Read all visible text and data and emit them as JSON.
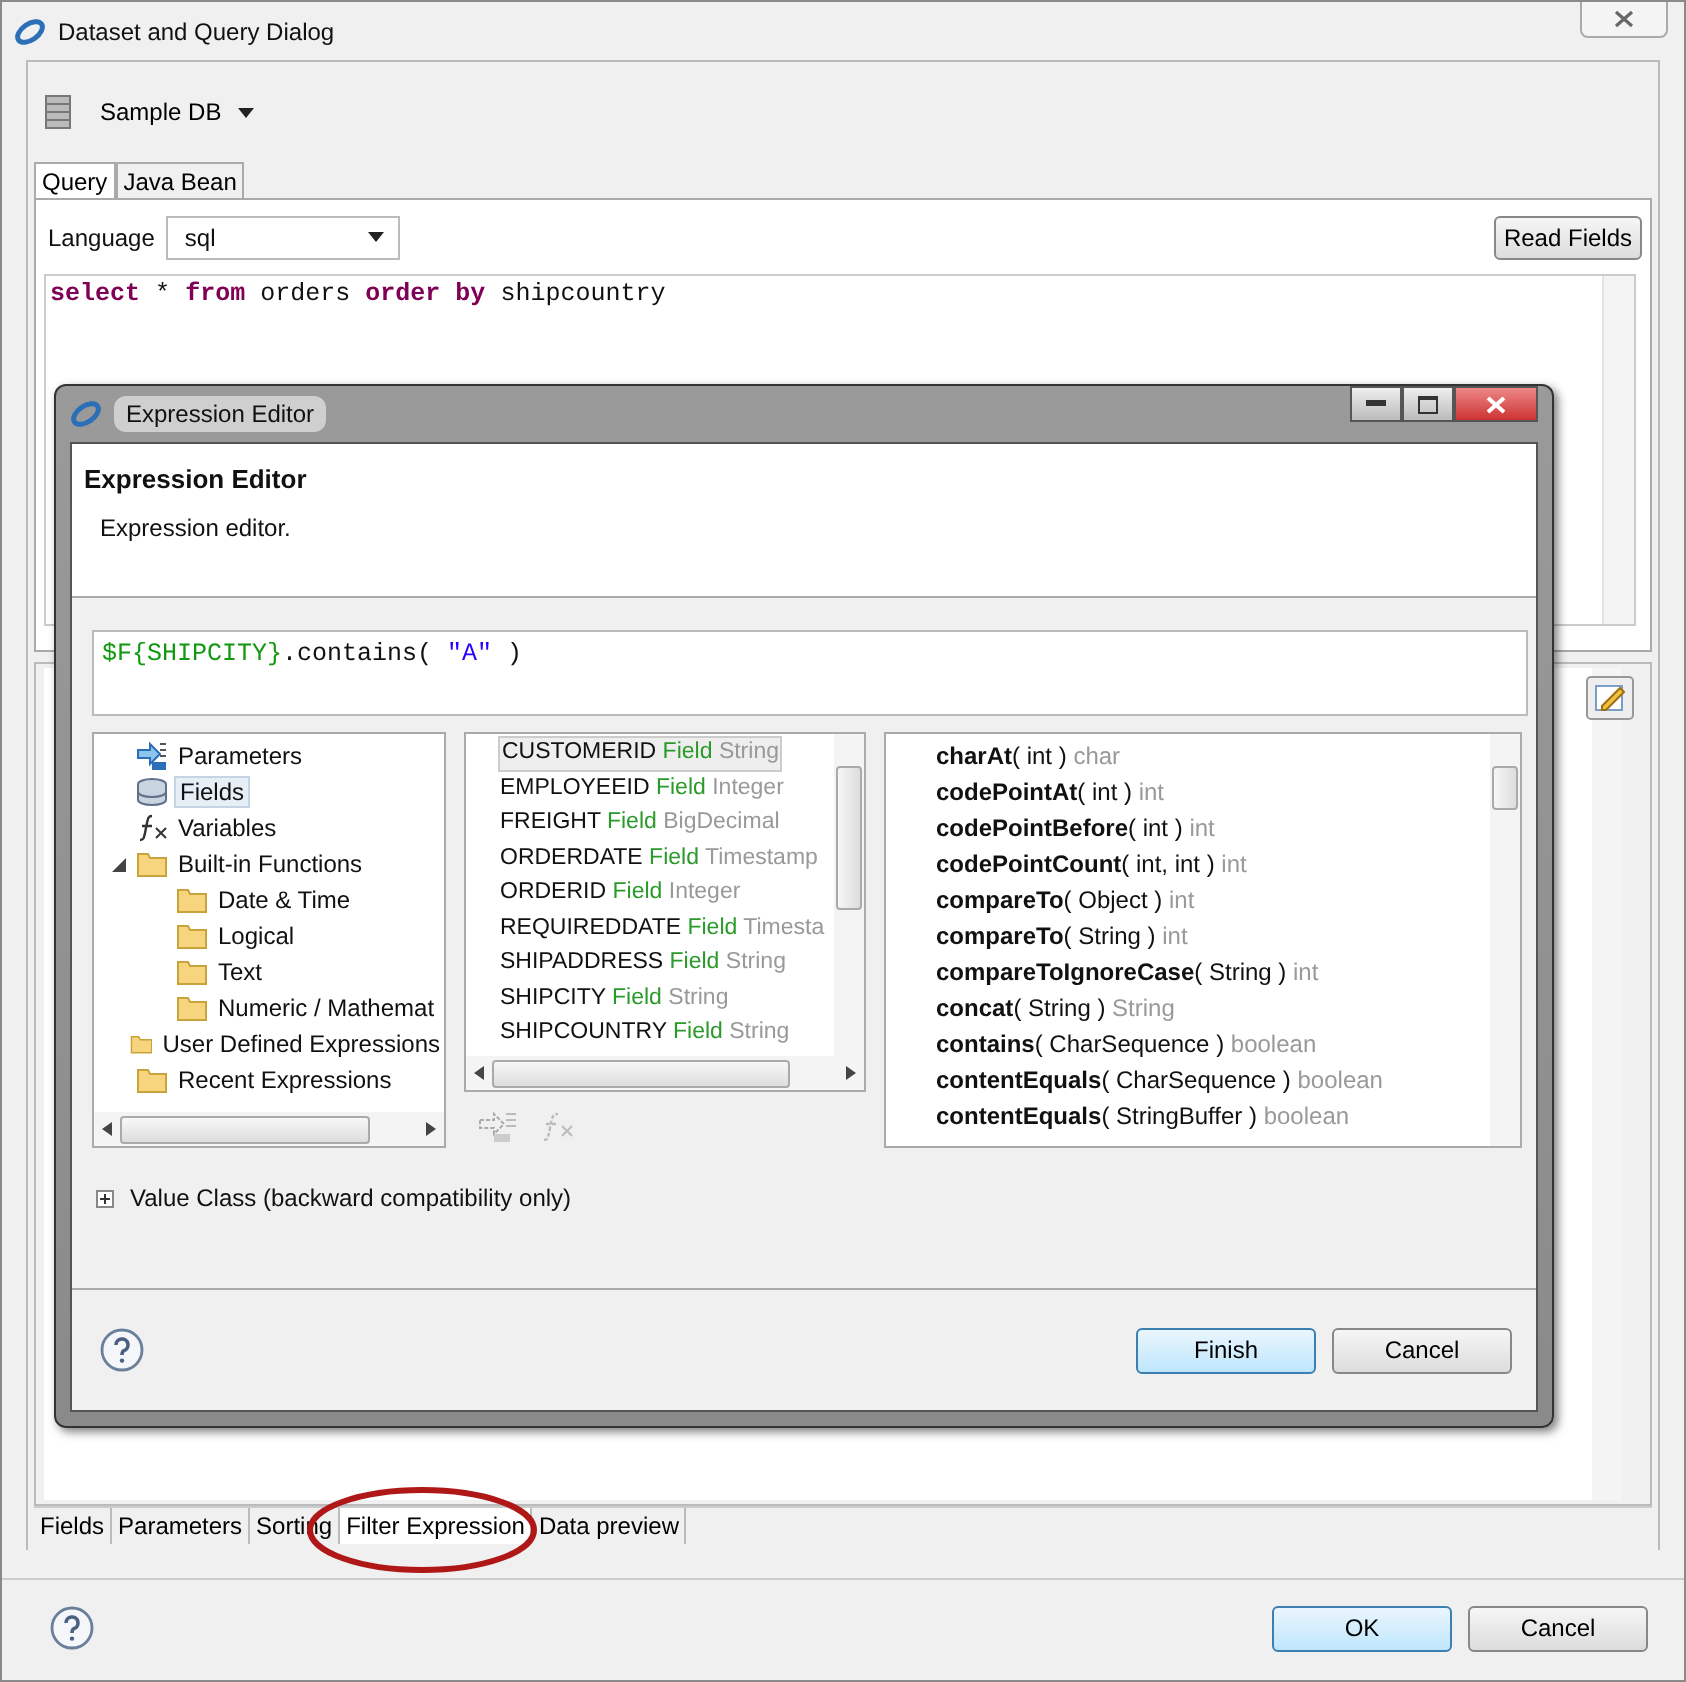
{
  "window": {
    "title": "Dataset and Query Dialog"
  },
  "data_source": {
    "label": "Sample DB"
  },
  "query_tabs": [
    {
      "label": "Query",
      "selected": true
    },
    {
      "label": "Java Bean",
      "selected": false
    }
  ],
  "language": {
    "label": "Language",
    "value": "sql"
  },
  "read_fields_button": "Read Fields",
  "query_tokens": [
    {
      "text": "select",
      "kind": "keyword"
    },
    {
      "text": "*",
      "kind": "plain"
    },
    {
      "text": "from",
      "kind": "keyword"
    },
    {
      "text": "orders",
      "kind": "plain"
    },
    {
      "text": "order",
      "kind": "keyword"
    },
    {
      "text": "by",
      "kind": "keyword"
    },
    {
      "text": "shipcountry",
      "kind": "plain"
    }
  ],
  "expression_editor": {
    "title": "Expression Editor",
    "heading": "Expression Editor",
    "description": "Expression editor.",
    "expression_tokens": [
      {
        "text": "$F{SHIPCITY}",
        "kind": "field"
      },
      {
        "text": ".contains( ",
        "kind": "plain"
      },
      {
        "text": "\"A\"",
        "kind": "string"
      },
      {
        "text": " )",
        "kind": "plain"
      }
    ],
    "categories": [
      {
        "label": "Parameters",
        "kind": "parameters",
        "selected": false
      },
      {
        "label": "Fields",
        "kind": "fields",
        "selected": true
      },
      {
        "label": "Variables",
        "kind": "variables",
        "selected": false
      },
      {
        "label": "Built-in Functions",
        "kind": "folder",
        "selected": false,
        "expanded": true,
        "children": [
          {
            "label": "Date & Time",
            "kind": "folder",
            "selected": false
          },
          {
            "label": "Logical",
            "kind": "folder",
            "selected": false
          },
          {
            "label": "Text",
            "kind": "folder",
            "selected": false
          },
          {
            "label": "Numeric / Mathemat",
            "kind": "folder",
            "selected": false
          }
        ]
      },
      {
        "label": "User Defined Expressions",
        "kind": "folder",
        "selected": false
      },
      {
        "label": "Recent Expressions",
        "kind": "folder",
        "selected": false
      }
    ],
    "fields": [
      {
        "name": "CUSTOMERID",
        "kind_label": "Field",
        "type": "String",
        "selected": true
      },
      {
        "name": "EMPLOYEEID",
        "kind_label": "Field",
        "type": "Integer",
        "selected": false
      },
      {
        "name": "FREIGHT",
        "kind_label": "Field",
        "type": "BigDecimal",
        "selected": false
      },
      {
        "name": "ORDERDATE",
        "kind_label": "Field",
        "type": "Timestamp",
        "selected": false
      },
      {
        "name": "ORDERID",
        "kind_label": "Field",
        "type": "Integer",
        "selected": false
      },
      {
        "name": "REQUIREDDATE",
        "kind_label": "Field",
        "type": "Timesta",
        "selected": false
      },
      {
        "name": "SHIPADDRESS",
        "kind_label": "Field",
        "type": "String",
        "selected": false
      },
      {
        "name": "SHIPCITY",
        "kind_label": "Field",
        "type": "String",
        "selected": false
      },
      {
        "name": "SHIPCOUNTRY",
        "kind_label": "Field",
        "type": "String",
        "selected": false
      }
    ],
    "methods": [
      {
        "name": "charAt",
        "params": "( int )",
        "returns": "char"
      },
      {
        "name": "codePointAt",
        "params": "( int )",
        "returns": "int"
      },
      {
        "name": "codePointBefore",
        "params": "( int )",
        "returns": "int"
      },
      {
        "name": "codePointCount",
        "params": "( int, int )",
        "returns": "int"
      },
      {
        "name": "compareTo",
        "params": "( Object )",
        "returns": "int"
      },
      {
        "name": "compareTo",
        "params": "( String )",
        "returns": "int"
      },
      {
        "name": "compareToIgnoreCase",
        "params": "( String )",
        "returns": "int"
      },
      {
        "name": "concat",
        "params": "( String )",
        "returns": "String"
      },
      {
        "name": "contains",
        "params": "( CharSequence )",
        "returns": "boolean"
      },
      {
        "name": "contentEquals",
        "params": "( CharSequence )",
        "returns": "boolean"
      },
      {
        "name": "contentEquals",
        "params": "( StringBuffer )",
        "returns": "boolean"
      }
    ],
    "value_class": {
      "label": "Value Class (backward compatibility only)",
      "expanded": false
    },
    "buttons": [
      "Finish",
      "Cancel"
    ]
  },
  "lower_tabs": [
    {
      "label": "Fields",
      "selected": false
    },
    {
      "label": "Parameters",
      "selected": false
    },
    {
      "label": "Sorting",
      "selected": false
    },
    {
      "label": "Filter Expression",
      "selected": true
    },
    {
      "label": "Data preview",
      "selected": false
    }
  ],
  "buttons": [
    "OK",
    "Cancel"
  ]
}
